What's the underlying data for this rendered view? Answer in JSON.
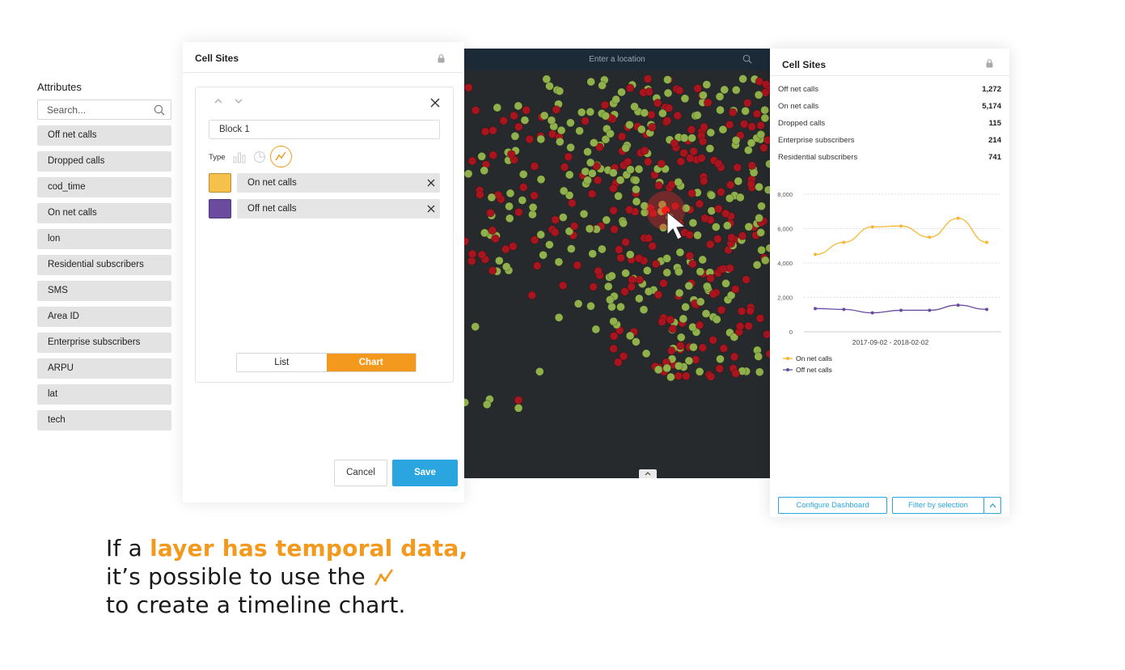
{
  "attributes": {
    "title": "Attributes",
    "search_placeholder": "Search...",
    "items": [
      "Off net calls",
      "Dropped calls",
      "cod_time",
      "On net calls",
      "lon",
      "Residential subscribers",
      "SMS",
      "Area ID",
      "Enterprise subscribers",
      "ARPU",
      "lat",
      "tech"
    ]
  },
  "editor": {
    "title": "Cell Sites",
    "block_name": "Block 1",
    "type_label": "Type",
    "series": [
      {
        "label": "On net calls",
        "color": "#f7c04a"
      },
      {
        "label": "Off net calls",
        "color": "#6a4ba0"
      }
    ],
    "toggle": {
      "list": "List",
      "chart": "Chart",
      "active": "Chart"
    },
    "cancel": "Cancel",
    "save": "Save"
  },
  "map": {
    "search_placeholder": "Enter a location",
    "colors": {
      "green": "#8fb04a",
      "red": "#a8151f",
      "highlight": "#ff1a1a"
    }
  },
  "dashboard": {
    "title": "Cell Sites",
    "stats": [
      {
        "label": "Off net calls",
        "value": "1,272"
      },
      {
        "label": "On net calls",
        "value": "5,174"
      },
      {
        "label": "Dropped calls",
        "value": "115"
      },
      {
        "label": "Enterprise subscribers",
        "value": "214"
      },
      {
        "label": "Residential subscribers",
        "value": "741"
      }
    ],
    "configure": "Configure Dashboard",
    "filter": "Filter by selection"
  },
  "chart_data": {
    "type": "line",
    "xlabel": "2017-09-02 - 2018-02-02",
    "ylim": [
      0,
      8000
    ],
    "yticks": [
      0,
      2000,
      4000,
      6000,
      8000
    ],
    "ytick_labels": [
      "0",
      "2,000",
      "4,000",
      "6,000",
      "8,000"
    ],
    "grid": true,
    "legend_position": "bottom-left",
    "series": [
      {
        "name": "On net calls",
        "color": "#f7b733",
        "values": [
          4500,
          5200,
          6100,
          6150,
          5500,
          6600,
          5200
        ]
      },
      {
        "name": "Off net calls",
        "color": "#6a4ba0",
        "values": [
          1350,
          1300,
          1100,
          1250,
          1250,
          1550,
          1300
        ]
      }
    ]
  },
  "caption": {
    "line1_prefix": "If a ",
    "line1_highlight": "layer has temporal data,",
    "line2": "it’s possible to use the",
    "line3": "to create a timeline chart."
  }
}
